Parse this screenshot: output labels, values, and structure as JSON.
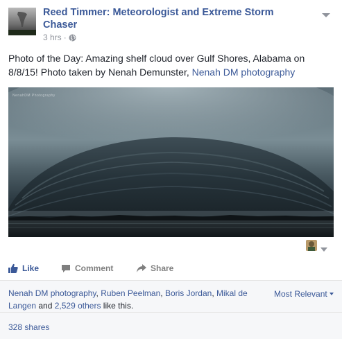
{
  "post": {
    "author": "Reed Timmer: Meteorologist and Extreme Storm Chaser",
    "time": "3 hrs",
    "separator": "·",
    "text_main": "Photo of the Day: Amazing shelf cloud over Gulf Shores, Alabama on 8/8/15! Photo taken by Nenah Demunster, ",
    "text_link": "Nenah DM photography",
    "photo_watermark": "NenahDM Photography",
    "icons": {
      "privacy": "globe-icon",
      "options": "chevron-down-icon",
      "like": "thumbs-up-icon",
      "comment": "comment-bubble-icon",
      "share": "share-arrow-icon"
    }
  },
  "actions": {
    "like": "Like",
    "comment": "Comment",
    "share": "Share"
  },
  "likes": {
    "names": [
      "Nenah DM photography",
      "Ruben Peelman",
      "Boris Jordan",
      "Mikal de Langen"
    ],
    "sep1": ", ",
    "sep2": ", ",
    "sep3": ", ",
    "and_text": " and ",
    "others": "2,529 others",
    "suffix": " like this.",
    "sort_label": "Most Relevant"
  },
  "shares": {
    "label": "328 shares"
  },
  "colors": {
    "link": "#3b5998",
    "text": "#1d2129",
    "muted": "#90949c",
    "panel": "#f6f7f9"
  }
}
